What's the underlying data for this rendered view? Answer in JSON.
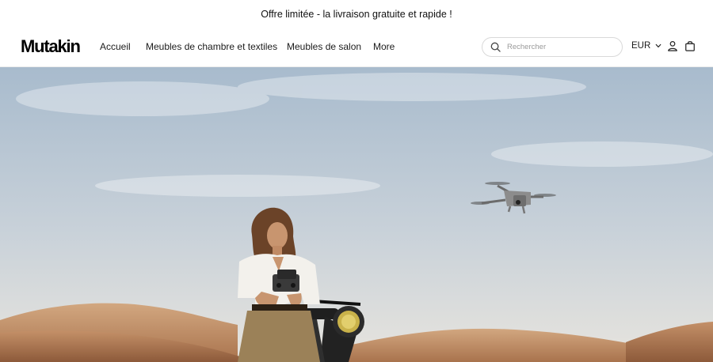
{
  "announcement": {
    "text": "Offre limitée - la livraison gratuite et rapide !"
  },
  "header": {
    "logo": "Mutakin",
    "nav": [
      {
        "label": "Accueil"
      },
      {
        "label": "Meubles de chambre et textiles"
      },
      {
        "label": "Meubles de salon"
      },
      {
        "label": "More"
      }
    ],
    "search": {
      "placeholder": "Rechercher",
      "value": "",
      "icon": "search-icon"
    },
    "currency": {
      "label": "EUR",
      "icon": "chevron-down-icon"
    },
    "account_icon": "user-icon",
    "cart_icon": "shopping-bag-icon"
  },
  "hero": {
    "image": "hero-image",
    "colors": {
      "sky_top": "#a9bccd",
      "sky_bottom": "#e6e4df",
      "sand": "#c79a72"
    }
  }
}
